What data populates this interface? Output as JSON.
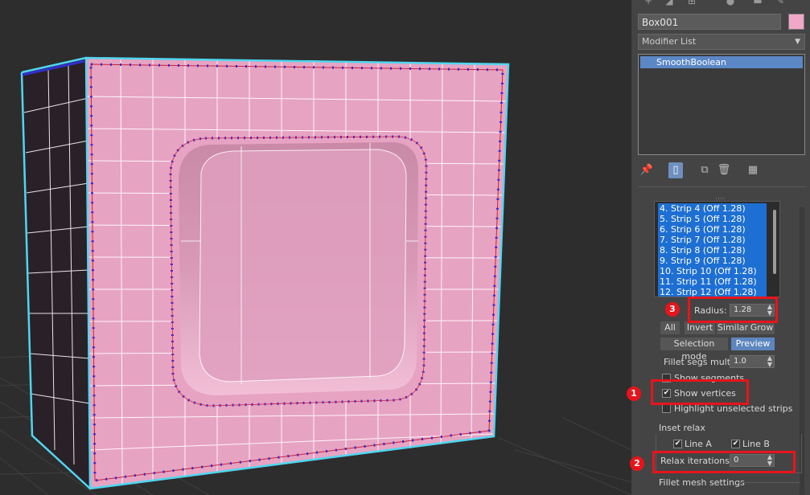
{
  "panel": {
    "object_name": "Box001",
    "object_color": "#f0a8c8",
    "modifier_list": "Modifier List",
    "stack_item": "SmoothBoolean",
    "strips": [
      "4. Strip 4 (Off  1.28)",
      "5. Strip 5 (Off  1.28)",
      "6. Strip 6 (Off  1.28)",
      "7. Strip 7 (Off  1.28)",
      "8. Strip 8 (Off  1.28)",
      "9. Strip 9 (Off  1.28)",
      "10. Strip 10 (Off  1.28)",
      "11. Strip 11 (Off  1.28)",
      "12. Strip 12 (Off  1.28)"
    ],
    "radius_label": "Radius:",
    "radius_value": "1.28",
    "btn_all": "All",
    "btn_invert": "Invert",
    "btn_similar": "Similar",
    "btn_grow": "Grow",
    "btn_selection_mode": "Selection mode",
    "btn_preview": "Preview",
    "fillet_label": "Fillet segs mult.:",
    "fillet_value": "1.0",
    "show_segments": "Show segments",
    "show_vertices": "Show vertices",
    "highlight_unselected": "Highlight unselected strips",
    "inset_relax": "Inset relax",
    "line_a": "Line A",
    "line_b": "Line B",
    "relax_label": "Relax iterations:",
    "relax_value": "0",
    "fillet_mesh": "Fillet mesh settings"
  },
  "annotations": {
    "badge1": "1",
    "badge2": "2",
    "badge3": "3"
  },
  "colors": {
    "accent_red": "#e8141b",
    "selection_blue": "#1e6fd2",
    "box_pink": "#e7a3c2",
    "wire_cyan": "#4fd6f0"
  }
}
